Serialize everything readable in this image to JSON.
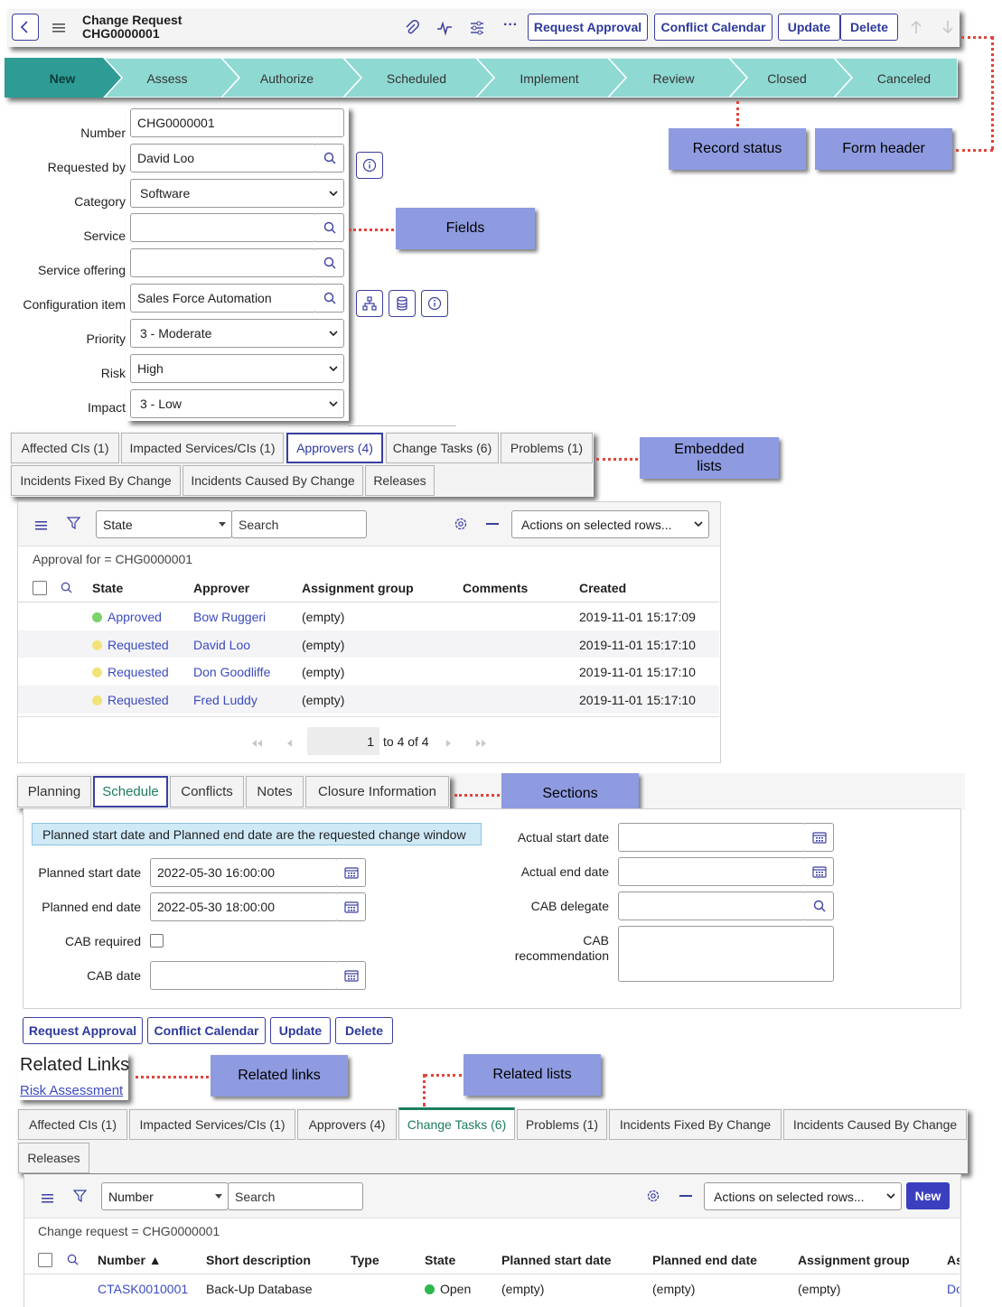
{
  "header": {
    "title": "Change Request",
    "number": "CHG0000001",
    "buttons": [
      "Request Approval",
      "Conflict Calendar",
      "Update",
      "Delete"
    ],
    "more_label": "···"
  },
  "stages": [
    "New",
    "Assess",
    "Authorize",
    "Scheduled",
    "Implement",
    "Review",
    "Closed",
    "Canceled"
  ],
  "callouts": {
    "record_status": "Record status",
    "form_header": "Form header",
    "fields": "Fields",
    "embedded_lists": "Embedded\nlists",
    "sections": "Sections",
    "related_links": "Related links",
    "related_lists": "Related lists"
  },
  "form": {
    "fields": [
      {
        "label": "Number",
        "value": "CHG0000001"
      },
      {
        "label": "Requested by",
        "value": "David Loo"
      },
      {
        "label": "Category",
        "value": "Software"
      },
      {
        "label": "Service",
        "value": ""
      },
      {
        "label": "Service offering",
        "value": ""
      },
      {
        "label": "Configuration item",
        "value": "Sales Force Automation"
      },
      {
        "label": "Priority",
        "value": "3 - Moderate"
      },
      {
        "label": "Risk",
        "value": "High"
      },
      {
        "label": "Impact",
        "value": "3 - Low"
      }
    ]
  },
  "embedded_tabs": {
    "row1": [
      "Affected CIs (1)",
      "Impacted Services/CIs (1)",
      "Approvers (4)",
      "Change Tasks (6)",
      "Problems (1)"
    ],
    "row2": [
      "Incidents Fixed By Change",
      "Incidents Caused By Change",
      "Releases"
    ]
  },
  "approvals_list": {
    "filter_field": "State",
    "search_placeholder": "Search",
    "actions": "Actions on selected rows...",
    "breadcrumb": "Approval for = CHG0000001",
    "columns": [
      "State",
      "Approver",
      "Assignment group",
      "Comments",
      "Created"
    ],
    "rows": [
      {
        "state": "Approved",
        "approver": "Bow Ruggeri",
        "group": "(empty)",
        "comments": "",
        "created": "2019-11-01 15:17:09",
        "color": "#7bd36a"
      },
      {
        "state": "Requested",
        "approver": "David Loo",
        "group": "(empty)",
        "comments": "",
        "created": "2019-11-01 15:17:10",
        "color": "#f2e27a"
      },
      {
        "state": "Requested",
        "approver": "Don Goodliffe",
        "group": "(empty)",
        "comments": "",
        "created": "2019-11-01 15:17:10",
        "color": "#f2e27a"
      },
      {
        "state": "Requested",
        "approver": "Fred Luddy",
        "group": "(empty)",
        "comments": "",
        "created": "2019-11-01 15:17:10",
        "color": "#f2e27a"
      }
    ],
    "pager_value": "1",
    "pager_text": "to 4 of 4"
  },
  "section_tabs": [
    "Planning",
    "Schedule",
    "Conflicts",
    "Notes",
    "Closure Information"
  ],
  "schedule": {
    "info": "Planned start date and Planned end date are the requested change window",
    "planned_start_label": "Planned start date",
    "planned_start": "2022-05-30 16:00:00",
    "planned_end_label": "Planned end date",
    "planned_end": "2022-05-30 18:00:00",
    "cab_required_label": "CAB required",
    "cab_date_label": "CAB date",
    "actual_start_label": "Actual start date",
    "actual_end_label": "Actual end date",
    "cab_delegate_label": "CAB delegate",
    "cab_recommendation_label": "CAB\nrecommendation"
  },
  "bottom_buttons": [
    "Request Approval",
    "Conflict Calendar",
    "Update",
    "Delete"
  ],
  "related_links": {
    "title": "Related Links",
    "link": "Risk Assessment"
  },
  "related_tabs": {
    "row1": [
      "Affected CIs (1)",
      "Impacted Services/CIs (1)",
      "Approvers (4)",
      "Change Tasks (6)",
      "Problems (1)",
      "Incidents Fixed By Change",
      "Incidents Caused By Change"
    ],
    "row2": [
      "Releases"
    ]
  },
  "tasks_list": {
    "filter_field": "Number",
    "search_placeholder": "Search",
    "actions": "Actions on selected rows...",
    "new_label": "New",
    "breadcrumb": "Change request = CHG0000001",
    "columns": [
      "Number ▲",
      "Short description",
      "Type",
      "State",
      "Planned start date",
      "Planned end date",
      "Assignment group",
      "As"
    ],
    "row": {
      "number": "CTASK0010001",
      "desc": "Back-Up Database",
      "type": "",
      "state": "Open",
      "start": "(empty)",
      "end": "(empty)",
      "group": "(empty)",
      "assigned": "Do"
    }
  }
}
